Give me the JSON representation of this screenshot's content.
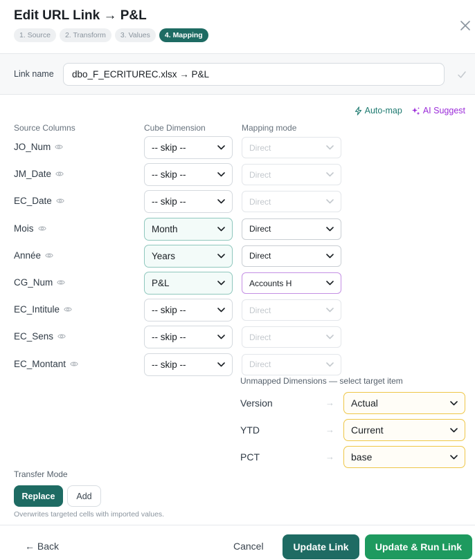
{
  "dialog": {
    "title": "Edit URL Link → P&L",
    "steps": [
      "1. Source",
      "2. Transform",
      "3. Values",
      "4. Mapping"
    ]
  },
  "link": {
    "name_label": "Link name",
    "name_value": "dbo_F_ECRITUREC.xlsx → P&L"
  },
  "actions": {
    "automap": "Auto-map",
    "ai_suggest": "AI Suggest"
  },
  "headers": {
    "source": "Source Columns",
    "dimension": "Cube Dimension",
    "mode": "Mapping mode"
  },
  "rows": [
    {
      "source": "JO_Num",
      "dimension": "-- skip --",
      "mode": "Direct"
    },
    {
      "source": "JM_Date",
      "dimension": "-- skip --",
      "mode": "Direct"
    },
    {
      "source": "EC_Date",
      "dimension": "-- skip --",
      "mode": "Direct"
    },
    {
      "source": "Mois",
      "dimension": "Month",
      "mode": "Direct"
    },
    {
      "source": "Année",
      "dimension": "Years",
      "mode": "Direct"
    },
    {
      "source": "CG_Num",
      "dimension": "P&L",
      "mode": "Accounts H"
    },
    {
      "source": "EC_Intitule",
      "dimension": "-- skip --",
      "mode": "Direct"
    },
    {
      "source": "EC_Sens",
      "dimension": "-- skip --",
      "mode": "Direct"
    },
    {
      "source": "EC_Montant",
      "dimension": "-- skip --",
      "mode": "Direct"
    }
  ],
  "unmapped": {
    "title": "Unmapped Dimensions — select target item",
    "items": [
      {
        "dimension": "Version",
        "value": "Actual"
      },
      {
        "dimension": "YTD",
        "value": "Current"
      },
      {
        "dimension": "PCT",
        "value": "base"
      }
    ]
  },
  "transfer": {
    "label": "Transfer Mode",
    "replace": "Replace",
    "add": "Add",
    "hint": "Overwrites targeted cells with imported values."
  },
  "footer": {
    "back": "← Back",
    "cancel": "Cancel",
    "update": "Update Link",
    "update_run": "Update & Run Link"
  },
  "colors": {
    "primary": "#1e6b63",
    "run": "#1e9a5f",
    "ai": "#9b2bd9",
    "unmapped_border": "#eec646"
  }
}
